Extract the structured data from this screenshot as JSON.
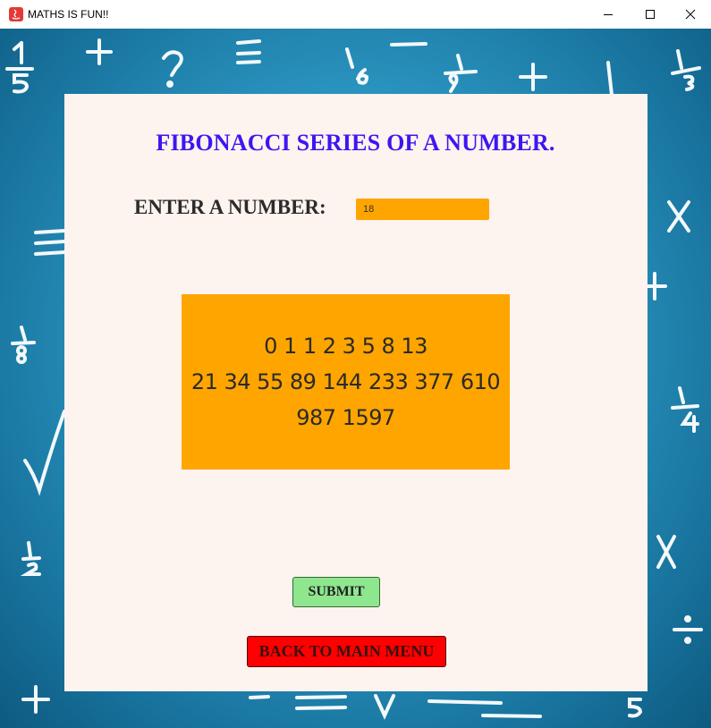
{
  "window": {
    "title": "MATHS IS FUN!!",
    "icon": "java-app-icon"
  },
  "form": {
    "heading": "FIBONACCI SERIES OF A NUMBER.",
    "input_label": "ENTER A NUMBER:",
    "input_value": "18",
    "result_lines": [
      "0 1 1 2 3 5 8 13",
      "21 34 55 89 144 233 377 610",
      "987 1597"
    ],
    "submit_label": "SUBMIT",
    "back_label": "BACK TO MAIN MENU"
  },
  "colors": {
    "heading": "#3d16f2",
    "input_bg": "#ffa500",
    "result_bg": "#ffa500",
    "submit_bg": "#8ee68e",
    "back_bg": "#ff0000",
    "card_bg": "#fdf3ef",
    "backdrop": "#2a94bf"
  }
}
